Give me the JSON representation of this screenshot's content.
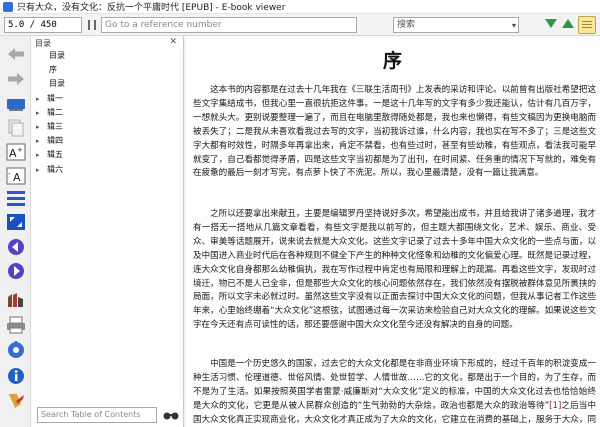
{
  "window": {
    "title": "只有大众，没有文化：反抗一个平庸时代 [EPUB] - E-book viewer"
  },
  "top_toolbar": {
    "position_value": "5.0 / 450",
    "reference_placeholder": "Go to a reference number",
    "search_value": "搜索"
  },
  "left_toolbar": {
    "icons": [
      "back-arrow-icon",
      "forward-arrow-icon",
      "open-ebook-icon",
      "copy-icon",
      "font-larger-icon",
      "font-smaller-icon",
      "toc-icon",
      "fullscreen-icon",
      "previous-page-icon",
      "next-page-icon",
      "reference-mode-icon",
      "print-icon",
      "preferences-icon",
      "info-icon",
      "bookmark-icon"
    ]
  },
  "toc": {
    "header": "目录",
    "items": [
      {
        "label": "目录",
        "expandable": false,
        "sub": true
      },
      {
        "label": "序",
        "expandable": false,
        "sub": true
      },
      {
        "label": "目录",
        "expandable": false,
        "sub": true
      },
      {
        "label": "辑一",
        "expandable": true,
        "sub": false
      },
      {
        "label": "辑二",
        "expandable": true,
        "sub": false
      },
      {
        "label": "辑三",
        "expandable": true,
        "sub": false
      },
      {
        "label": "辑四",
        "expandable": true,
        "sub": false
      },
      {
        "label": "辑五",
        "expandable": true,
        "sub": false
      },
      {
        "label": "辑六",
        "expandable": true,
        "sub": false
      }
    ],
    "search_placeholder": "Search Table of Contents"
  },
  "content": {
    "chapter_title": "序",
    "paragraphs": [
      "这本书的内容都是在过去十几年我在《三联生活周刊》上发表的采访和评论。以前曾有出版社希望把这些文字集结成书，但我心里一直很抗拒这件事。一是这十几年写的文字有多少我还能认，估计有几百万字，一想就头大。更别说要整理一遍了，而且在电脑里散得随处都是，我也来也懒得，有些文稿因为更换电脑而被丢失了；二是我从未喜欢看我过去写的文字，当初我诉过谁，什么内容，我也实在写不多了；三是这些文字大都有时效性，时隔多年再拿出来，肯定不禁看，也有些过时，甚至有些幼稚，有些观点，看法我可能早就变了，自己看都觉得矛盾，四是这些文字当初都是为了出刊，在时间紧、任务重的情况下写就的，难免有在疲惫的最后一刻才写完，有点萝卜快了不洗泥。所以，我心里最清楚，没有一篇让我满意。",
      "之所以还要拿出来献丑，主要是编辑罗丹坚持说好多次，希望能出成书，并且给我讲了诸多道理，我才有一搭无一搭地从几篇文章看看，有些文字是我以前写的，但主题大都围绕文化，艺术、娱乐、商业、受众、审美等话题展开，说来说去就是大众文化。这些文字记录了过去十多年中国大众文化的一些点与面，以及中国进入商业时代后在各种规则不健全下产生的种种文化怪象和幼稚的文化偏爱心理。既然是记录过程，连大众文化自身都那么幼稚偏执，我在写作过程中肯定也有局限和理解上的疏漏。再看这些文字，发现时过境迁，物已不是人已全非，但是那些大众文化的核心问题依然存在，我们依然没有摆脱被群体意见所裹挟的局面，所以文字未必就过时。虽然这些文字没有以正面去探讨中国大众文化的问题，但我从事记者工作这些年来，心里始终绷着“大众文化”这根弦，试图通过每一次采访来检验自己对大众文化的理解。如果说这些文字在今天还有点可读性的话，那还要感谢中国大众文化至今还没有解决的自身的问题。",
      "中国是一个历史悠久的国家，过去它的大众文化都是在非商业环境下形成的，经过千百年的积淀变成一种生活习惯、伦理道德、世俗风情、处世哲学、人情世故……它的文化，都是出于一个目的，为了生存，而不是为了生活。如果按照英国学者雷蒙·威廉斯对“大众文化”定义的标准，中国的大众文化过去也恰恰始终是大众的文化，它更是从被人民群众创造的“生气勃勃的大杂烩，政治也都是大众的政治等待”",
      "之后当中国大众文化真正实现商业化，大众文化才真正成为了大众的文化，它建立在消费的基础上，服务于大众，同时也开始在..."
    ],
    "footnote_marker": "[1]"
  }
}
